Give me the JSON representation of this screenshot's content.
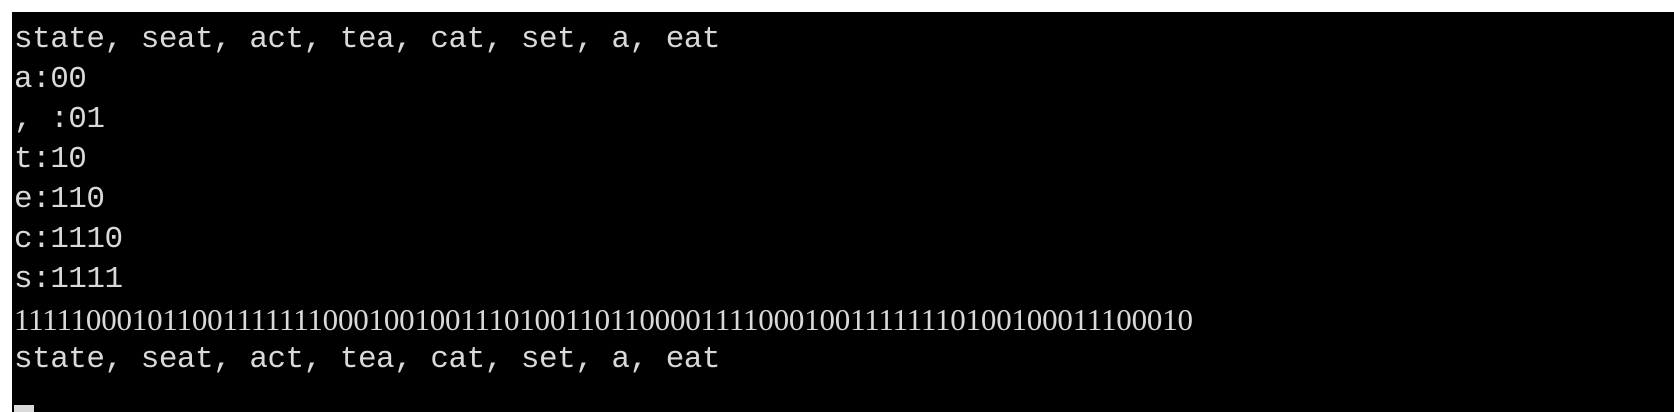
{
  "console": {
    "lines": [
      "state, seat, act, tea, cat, set, a, eat",
      "a:00",
      ", :01",
      "t:10",
      "e:110",
      "c:1110",
      "s:1111",
      "1111100010110011111110001001001110100110110000111100010011111110100100011100010",
      "state, seat, act, tea, cat, set, a, eat"
    ],
    "colors": {
      "background": "#000000",
      "text": "#d9d9d9"
    }
  }
}
